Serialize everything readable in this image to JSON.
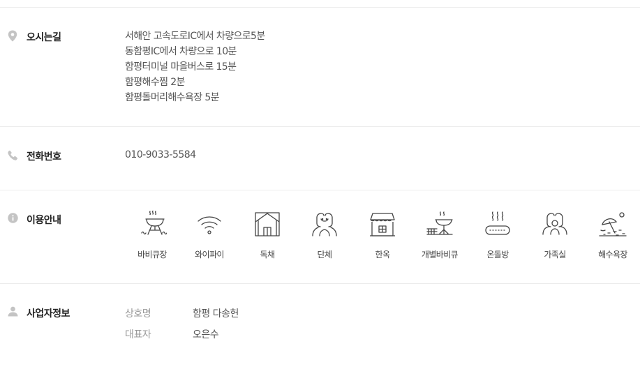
{
  "directions": {
    "title": "오시는길",
    "icon": "map-pin-icon",
    "lines": [
      "서해안 고속도로IC에서 차량으로5분",
      "동함평IC에서 차량으로 10분",
      "함평터미널 마을버스로 15분",
      "함평해수찜 2분",
      "함평돌머리해수욕장 5분"
    ]
  },
  "phone": {
    "title": "전화번호",
    "icon": "phone-icon",
    "number": "010-9033-5584"
  },
  "usage": {
    "title": "이용안내",
    "icon": "info-icon",
    "amenities": [
      {
        "label": "바비큐장",
        "icon": "bbq-grill-icon"
      },
      {
        "label": "와이파이",
        "icon": "wifi-icon"
      },
      {
        "label": "독채",
        "icon": "house-icon"
      },
      {
        "label": "단체",
        "icon": "group-icon"
      },
      {
        "label": "한옥",
        "icon": "hanok-icon"
      },
      {
        "label": "개별바비큐",
        "icon": "private-bbq-icon"
      },
      {
        "label": "온돌방",
        "icon": "ondol-icon"
      },
      {
        "label": "가족실",
        "icon": "family-room-icon"
      },
      {
        "label": "해수욕장",
        "icon": "beach-icon"
      }
    ]
  },
  "business": {
    "title": "사업자정보",
    "icon": "person-icon",
    "rows": [
      {
        "label": "상호명",
        "value": "함평 다송헌"
      },
      {
        "label": "대표자",
        "value": "오은수"
      }
    ]
  },
  "colors": {
    "icon_gray": "#c4c4c4",
    "line_icon": "#444444",
    "divider": "#ececec"
  }
}
